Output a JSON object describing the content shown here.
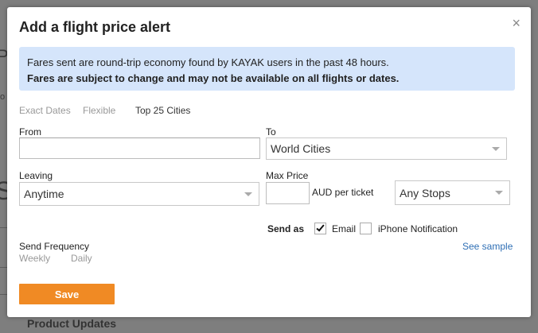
{
  "background": {
    "letter_a": "P",
    "small_text": "o",
    "letter_b": "S",
    "footer_text": "Product Updates"
  },
  "modal": {
    "title": "Add a flight price alert",
    "close_glyph": "×",
    "info": {
      "line1": "Fares sent are round-trip economy found by KAYAK users in the past 48 hours.",
      "line2": "Fares are subject to change and may not be available on all flights or dates."
    },
    "tabs": [
      {
        "label": "Exact Dates",
        "active": false
      },
      {
        "label": "Flexible",
        "active": false
      },
      {
        "label": "Top 25 Cities",
        "active": true
      }
    ],
    "from": {
      "label": "From",
      "value": ""
    },
    "to": {
      "label": "To",
      "value": "World Cities"
    },
    "leaving": {
      "label": "Leaving",
      "value": "Anytime"
    },
    "max_price": {
      "label": "Max Price",
      "value": "",
      "unit": "AUD per ticket"
    },
    "stops": {
      "value": "Any Stops"
    },
    "send_as": {
      "label": "Send as",
      "email": {
        "label": "Email",
        "checked": true
      },
      "iphone": {
        "label": "iPhone Notification",
        "checked": false
      },
      "see_sample": "See sample"
    },
    "frequency": {
      "label": "Send Frequency",
      "options": [
        "Weekly",
        "Daily"
      ]
    },
    "save_label": "Save"
  },
  "colors": {
    "accent": "#f08a24",
    "info_bg": "#d5e5fb",
    "link": "#2f6fb5"
  }
}
